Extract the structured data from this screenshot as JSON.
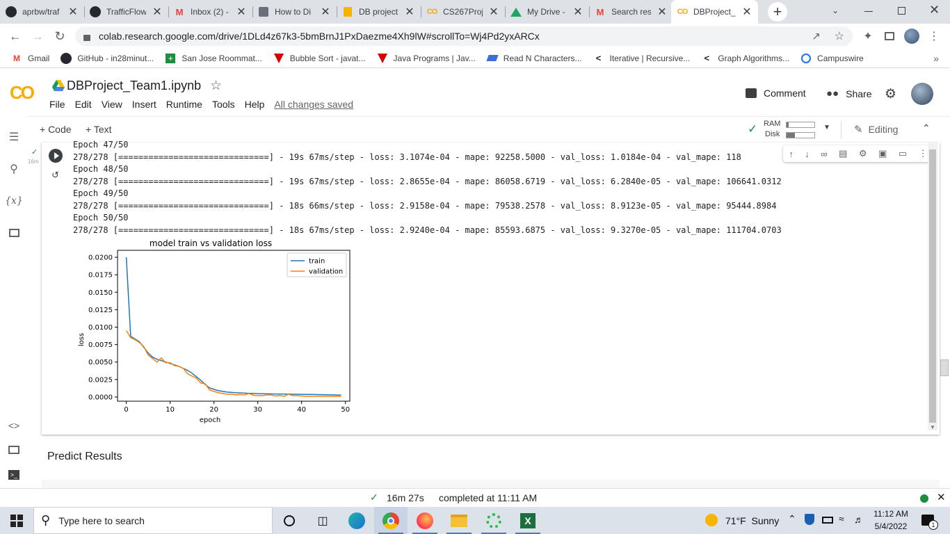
{
  "browser": {
    "tabs": [
      {
        "title": "aprbw/traf",
        "icon": "github-icon"
      },
      {
        "title": "TrafficFlow",
        "icon": "github-icon"
      },
      {
        "title": "Inbox (2) -",
        "icon": "gmail-icon"
      },
      {
        "title": "How to Di",
        "icon": "webpage-icon"
      },
      {
        "title": "DB project",
        "icon": "slides-icon"
      },
      {
        "title": "CS267Proj",
        "icon": "colab-icon"
      },
      {
        "title": "My Drive -",
        "icon": "drive-icon"
      },
      {
        "title": "Search resu",
        "icon": "gmail-icon"
      },
      {
        "title": "DBProject_",
        "icon": "colab-icon",
        "active": true
      }
    ],
    "url": "colab.research.google.com/drive/1DLd4z67k3-5bmBrnJ1PxDaezme4Xh9lW#scrollTo=Wj4Pd2yxARCx",
    "bookmarks": [
      {
        "label": "Gmail",
        "icon": "gmail-icon"
      },
      {
        "label": "GitHub - in28minut...",
        "icon": "github-icon"
      },
      {
        "label": "San Jose Roommat...",
        "icon": "plus-green-icon"
      },
      {
        "label": "Bubble Sort - javat...",
        "icon": "javatpoint-icon"
      },
      {
        "label": "Java Programs | Jav...",
        "icon": "javatpoint-icon"
      },
      {
        "label": "Read N Characters...",
        "icon": "layers-icon"
      },
      {
        "label": "Iterative | Recursive...",
        "icon": "leetcode-icon"
      },
      {
        "label": "Graph Algorithms...",
        "icon": "leetcode-icon"
      },
      {
        "label": "Campuswire",
        "icon": "campuswire-icon"
      }
    ]
  },
  "colab": {
    "logo": "CO",
    "notebook_title": "DBProject_Team1.ipynb",
    "menu": [
      "File",
      "Edit",
      "View",
      "Insert",
      "Runtime",
      "Tools",
      "Help"
    ],
    "saved_status": "All changes saved",
    "comment_label": "Comment",
    "share_label": "Share",
    "add_code_label": "+ Code",
    "add_text_label": "+ Text",
    "ram_label": "RAM",
    "disk_label": "Disk",
    "ram_usage": 0.08,
    "disk_usage": 0.3,
    "editing_label": "Editing",
    "cell_exec_time": "16m",
    "output_lines": [
      "Epoch 47/50",
      "278/278 [==============================] - 19s 67ms/step - loss: 3.1074e-04 - mape: 92258.5000 - val_loss: 1.0184e-04 - val_mape: 118",
      "Epoch 48/50",
      "278/278 [==============================] - 19s 67ms/step - loss: 2.8655e-04 - mape: 86058.6719 - val_loss: 6.2840e-05 - val_mape: 106641.0312",
      "Epoch 49/50",
      "278/278 [==============================] - 18s 66ms/step - loss: 2.9158e-04 - mape: 79538.2578 - val_loss: 8.9123e-05 - val_mape: 95444.8984",
      "Epoch 50/50",
      "278/278 [==============================] - 18s 67ms/step - loss: 2.9240e-04 - mape: 85593.6875 - val_loss: 9.3270e-05 - val_mape: 111704.0703"
    ],
    "next_cell_heading": "Predict Results",
    "status_elapsed": "16m 27s",
    "status_completed": "completed at 11:11 AM"
  },
  "chart_data": {
    "type": "line",
    "title": "model train vs validation loss",
    "xlabel": "epoch",
    "ylabel": "loss",
    "xlim": [
      -2,
      51
    ],
    "ylim": [
      -0.0006,
      0.021
    ],
    "xticks": [
      "0",
      "10",
      "20",
      "30",
      "40",
      "50"
    ],
    "yticks": [
      "0.0000",
      "0.0025",
      "0.0050",
      "0.0075",
      "0.0100",
      "0.0125",
      "0.0150",
      "0.0175",
      "0.0200"
    ],
    "legend_position": "upper right",
    "series": [
      {
        "name": "train",
        "color": "#1f77b4",
        "x": [
          0,
          1,
          2,
          3,
          4,
          5,
          6,
          7,
          8,
          9,
          10,
          11,
          12,
          13,
          14,
          15,
          16,
          17,
          18,
          19,
          20,
          21,
          22,
          23,
          24,
          25,
          26,
          27,
          28,
          29,
          30,
          31,
          32,
          33,
          34,
          35,
          36,
          37,
          38,
          39,
          40,
          41,
          42,
          43,
          44,
          45,
          46,
          47,
          48,
          49
        ],
        "values": [
          0.02,
          0.0087,
          0.0083,
          0.0079,
          0.0071,
          0.0063,
          0.0057,
          0.0054,
          0.0052,
          0.005,
          0.0048,
          0.0046,
          0.0044,
          0.0041,
          0.0038,
          0.0034,
          0.0029,
          0.0024,
          0.0018,
          0.0013,
          0.0011,
          0.0009,
          0.0008,
          0.0007,
          0.00065,
          0.0006,
          0.00058,
          0.00055,
          0.00052,
          0.0005,
          0.00048,
          0.00047,
          0.00046,
          0.00045,
          0.00044,
          0.00043,
          0.00042,
          0.00041,
          0.0004,
          0.0004,
          0.00039,
          0.00038,
          0.00037,
          0.00036,
          0.00035,
          0.00034,
          0.00033,
          0.00031,
          0.00029,
          0.00029
        ]
      },
      {
        "name": "validation",
        "color": "#ff7f0e",
        "x": [
          0,
          1,
          2,
          3,
          4,
          5,
          6,
          7,
          8,
          9,
          10,
          11,
          12,
          13,
          14,
          15,
          16,
          17,
          18,
          19,
          20,
          21,
          22,
          23,
          24,
          25,
          26,
          27,
          28,
          29,
          30,
          31,
          32,
          33,
          34,
          35,
          36,
          37,
          38,
          39,
          40,
          41,
          42,
          43,
          44,
          45,
          46,
          47,
          48,
          49
        ],
        "values": [
          0.0095,
          0.0085,
          0.0082,
          0.0078,
          0.0072,
          0.006,
          0.0055,
          0.005,
          0.0056,
          0.0049,
          0.0049,
          0.0045,
          0.0044,
          0.0041,
          0.0033,
          0.003,
          0.0027,
          0.002,
          0.0019,
          0.001,
          0.0008,
          0.0006,
          0.0005,
          0.0004,
          0.0004,
          0.0003,
          0.00035,
          0.0003,
          0.0005,
          0.00025,
          0.0002,
          0.0002,
          0.0003,
          0.0003,
          0.00015,
          0.0002,
          0.0001,
          0.0004,
          0.0002,
          0.0002,
          0.00015,
          0.0001,
          0.0001,
          0.0001,
          0.00012,
          0.0001,
          0.0001,
          0.0001,
          0.0001,
          9e-05
        ]
      }
    ]
  },
  "taskbar": {
    "search_placeholder": "Type here to search",
    "weather": "71°F  Sunny",
    "time": "11:12 AM",
    "date": "5/4/2022",
    "notification_count": "1"
  }
}
